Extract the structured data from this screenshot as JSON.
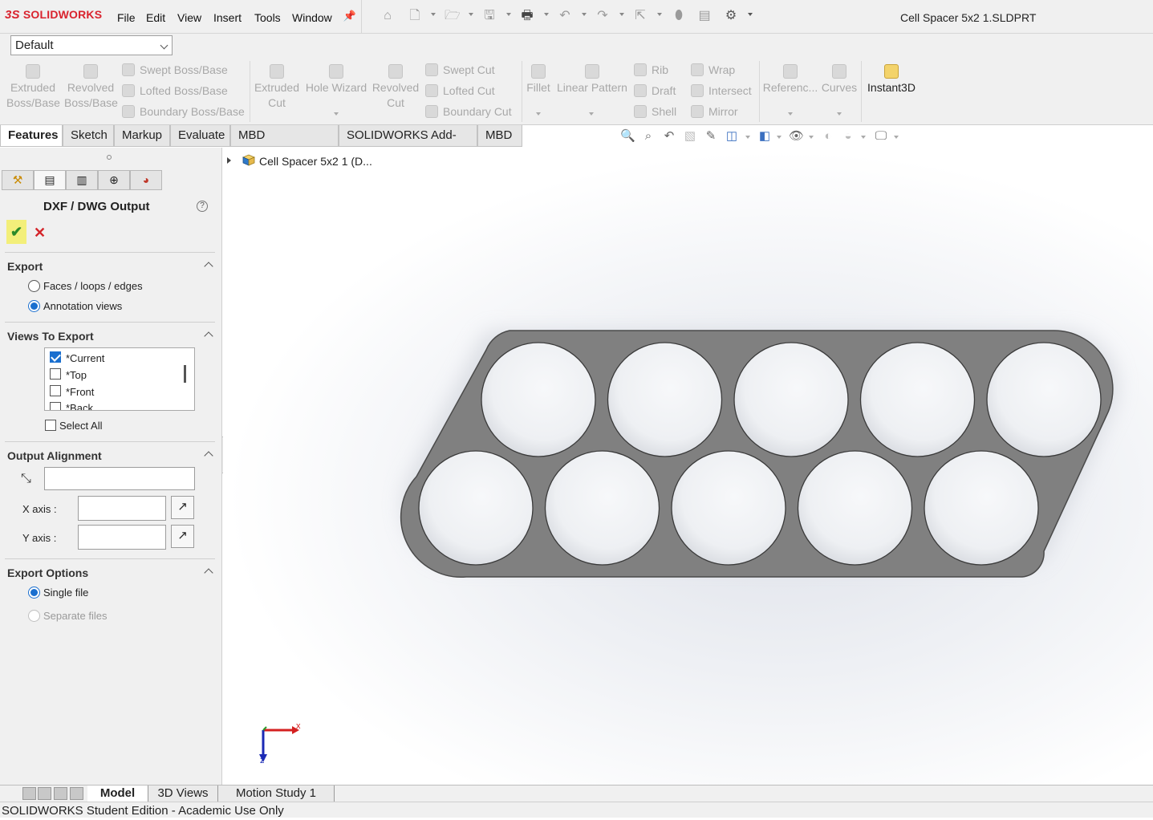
{
  "app": {
    "logo_prefix": "3S",
    "logo_text": "SOLIDWORKS",
    "document_title": "Cell Spacer 5x2 1.SLDPRT"
  },
  "menu": [
    "File",
    "Edit",
    "View",
    "Insert",
    "Tools",
    "Window"
  ],
  "configuration": {
    "value": "Default"
  },
  "command_manager": {
    "buttons": {
      "extruded_boss": "Extruded\nBoss/Base",
      "revolved_boss": "Revolved\nBoss/Base",
      "swept_boss": "Swept Boss/Base",
      "lofted_boss": "Lofted Boss/Base",
      "boundary_boss": "Boundary Boss/Base",
      "extruded_cut": "Extruded\nCut",
      "hole_wizard": "Hole Wizard",
      "revolved_cut": "Revolved\nCut",
      "swept_cut": "Swept Cut",
      "lofted_cut": "Lofted Cut",
      "boundary_cut": "Boundary Cut",
      "fillet": "Fillet",
      "linear_pattern": "Linear Pattern",
      "rib": "Rib",
      "draft": "Draft",
      "shell": "Shell",
      "wrap": "Wrap",
      "intersect": "Intersect",
      "mirror": "Mirror",
      "reference": "Referenc...",
      "curves": "Curves",
      "instant3d": "Instant3D"
    },
    "tabs": [
      "Features",
      "Sketch",
      "Markup",
      "Evaluate",
      "MBD Dimensions",
      "SOLIDWORKS Add-Ins",
      "MBD"
    ],
    "active_tab": "Features"
  },
  "property_manager": {
    "title": "DXF / DWG Output",
    "help": "?",
    "ok": "✔",
    "cancel": "✕",
    "export": {
      "heading": "Export",
      "options": [
        "Faces / loops / edges",
        "Annotation views"
      ],
      "selected": "Annotation views"
    },
    "views_to_export": {
      "heading": "Views To Export",
      "items": [
        {
          "label": "*Current",
          "checked": true
        },
        {
          "label": "*Top",
          "checked": false
        },
        {
          "label": "*Front",
          "checked": false
        },
        {
          "label": "*Back",
          "checked": false
        }
      ],
      "select_all": "Select All"
    },
    "output_alignment": {
      "heading": "Output Alignment",
      "origin_value": "",
      "x_axis_label": "X axis :",
      "x_axis_value": "",
      "y_axis_label": "Y axis :",
      "y_axis_value": ""
    },
    "export_options": {
      "heading": "Export Options",
      "options": [
        "Single file",
        "Separate files"
      ],
      "selected": "Single file"
    }
  },
  "feature_tree": {
    "root_label": "Cell Spacer 5x2 1 (D..."
  },
  "triad": {
    "x_label": "x",
    "z_label": "z"
  },
  "model": {
    "part_color": "#808080",
    "holes_top_row": 5,
    "holes_bottom_row": 5
  },
  "bottom_tabs": [
    "Model",
    "3D Views",
    "Motion Study 1"
  ],
  "active_bottom_tab": "Model",
  "status": "SOLIDWORKS Student Edition - Academic Use Only",
  "colors": {
    "accent": "#1a6fcf",
    "brand": "#d9232e",
    "ok_bg": "#f3ef7a"
  }
}
